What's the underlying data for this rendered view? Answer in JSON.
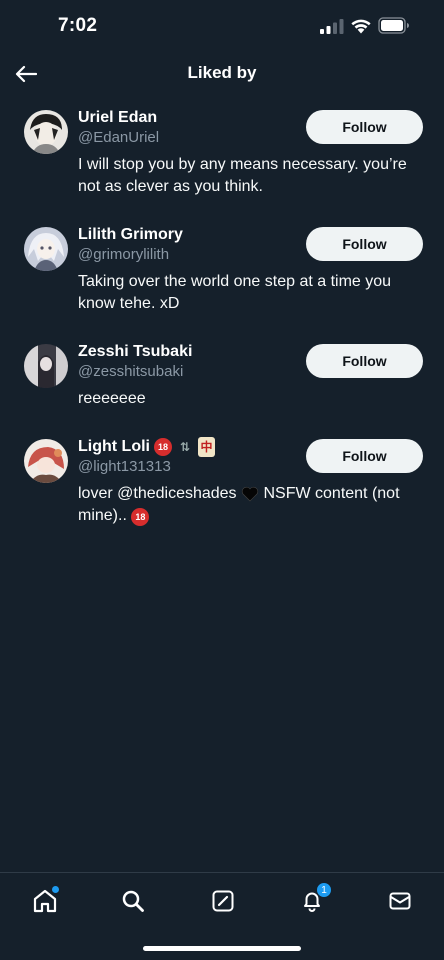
{
  "status_bar": {
    "time": "7:02"
  },
  "header": {
    "title": "Liked by"
  },
  "users": [
    {
      "name": "Uriel Edan",
      "handle": "@EdanUriel",
      "bio": "I will stop you by any means necessary. you’re not as clever as you think.",
      "follow_label": "Follow"
    },
    {
      "name": "Lilith Grimory",
      "handle": "@grimorylilith",
      "bio": "Taking over the world one step at a time you know tehe. xD",
      "follow_label": "Follow"
    },
    {
      "name": "Zesshi Tsubaki",
      "handle": "@zesshitsubaki",
      "bio": "reeeeeee",
      "follow_label": "Follow"
    },
    {
      "name": "Light Loli",
      "name_badges": [
        "18",
        "⇅",
        "中"
      ],
      "handle": "@light131313",
      "bio_part1": "lover @thediceshades",
      "bio_part2": "NSFW content (not mine)..",
      "bio_badge": "18",
      "follow_label": "Follow"
    }
  ],
  "bottom_nav": {
    "items": [
      "home-icon",
      "search-icon",
      "compose-icon",
      "bell-icon",
      "mail-icon"
    ],
    "notification_count": "1"
  },
  "colors": {
    "background": "#15202b",
    "accent": "#1d9bf0",
    "secondary_text": "#8b98a5",
    "button_bg": "#eff3f4"
  }
}
